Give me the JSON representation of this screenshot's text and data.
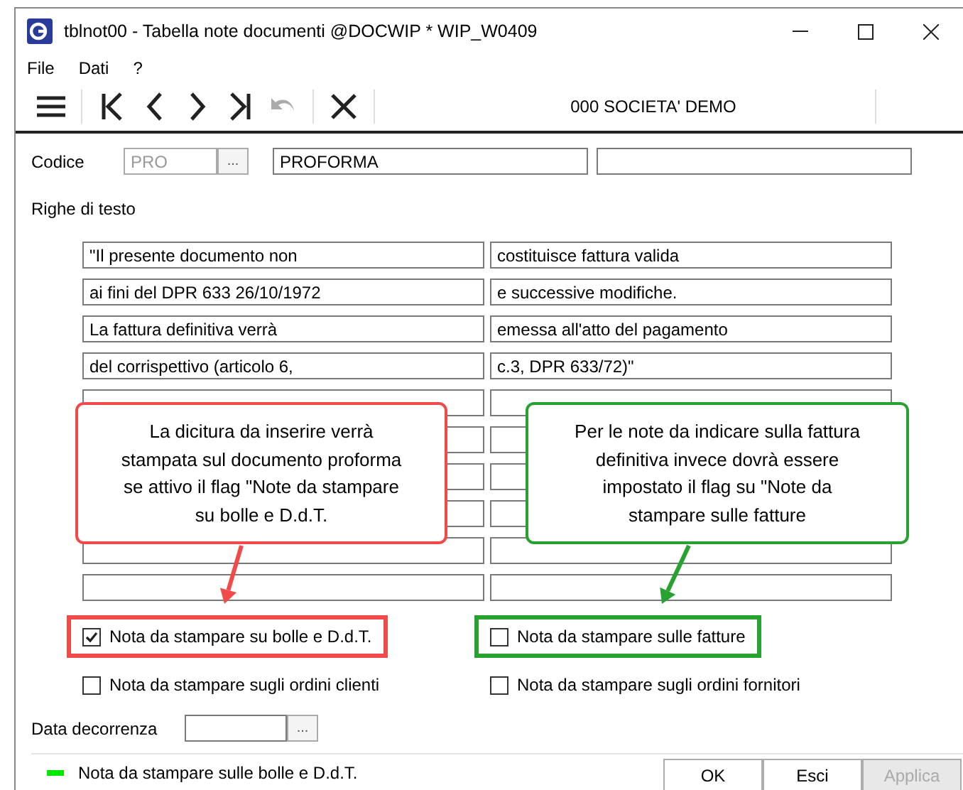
{
  "window": {
    "title": "tblnot00 - Tabella note documenti @DOCWIP * WIP_W0409"
  },
  "menu": [
    "File",
    "Dati",
    "?"
  ],
  "toolbar": {
    "company": "000 SOCIETA'  DEMO",
    "undo_disabled": true
  },
  "codice": {
    "label": "Codice",
    "code": "PRO",
    "code_disabled": true,
    "lookup": "...",
    "description": "PROFORMA"
  },
  "text_rows_label": "Righe di testo",
  "text_rows": [
    {
      "kind": "filled",
      "left": "\"Il presente documento non",
      "right": "costituisce fattura valida"
    },
    {
      "kind": "filled",
      "left": "ai fini del DPR 633 26/10/1972",
      "right": "e successive modifiche."
    },
    {
      "kind": "filled",
      "left": "La fattura definitiva verrà",
      "right": "emessa all'atto del pagamento"
    },
    {
      "kind": "filled",
      "left": "del corrispettivo (articolo 6,",
      "right": "c.3, DPR 633/72)\""
    },
    {
      "kind": "blank"
    },
    {
      "kind": "blank"
    },
    {
      "kind": "blank"
    },
    {
      "kind": "blank"
    },
    {
      "kind": "blank"
    },
    {
      "kind": "blank"
    }
  ],
  "checkboxes": [
    {
      "label": "Nota da stampare su bolle e D.d.T.",
      "checked": true
    },
    {
      "label": "Nota da stampare sulle fatture",
      "checked": false
    },
    {
      "label": "Nota da stampare sugli ordini clienti",
      "checked": false
    },
    {
      "label": "Nota da stampare sugli ordini fornitori",
      "checked": false
    }
  ],
  "date": {
    "label": "Data decorrenza",
    "lookup": "..."
  },
  "callouts": [
    {
      "text": "La dicitura da inserire verrà stampata sul documento proforma se attivo il flag \"Note da stampare su bolle e D.d.T.",
      "color": "#f04a4a"
    },
    {
      "text": "Per le note da indicare sulla fattura definitiva invece dovrà essere impostato il flag su \"Note da stampare sulle fatture",
      "color": "#27a12f"
    }
  ],
  "status_bar": {
    "color": "#00e600",
    "text": "Nota da stampare sulle bolle e D.d.T."
  },
  "buttons": [
    {
      "label": "OK",
      "disabled": false
    },
    {
      "label": "Esci",
      "disabled": false
    },
    {
      "label": "Applica",
      "disabled": true
    }
  ]
}
